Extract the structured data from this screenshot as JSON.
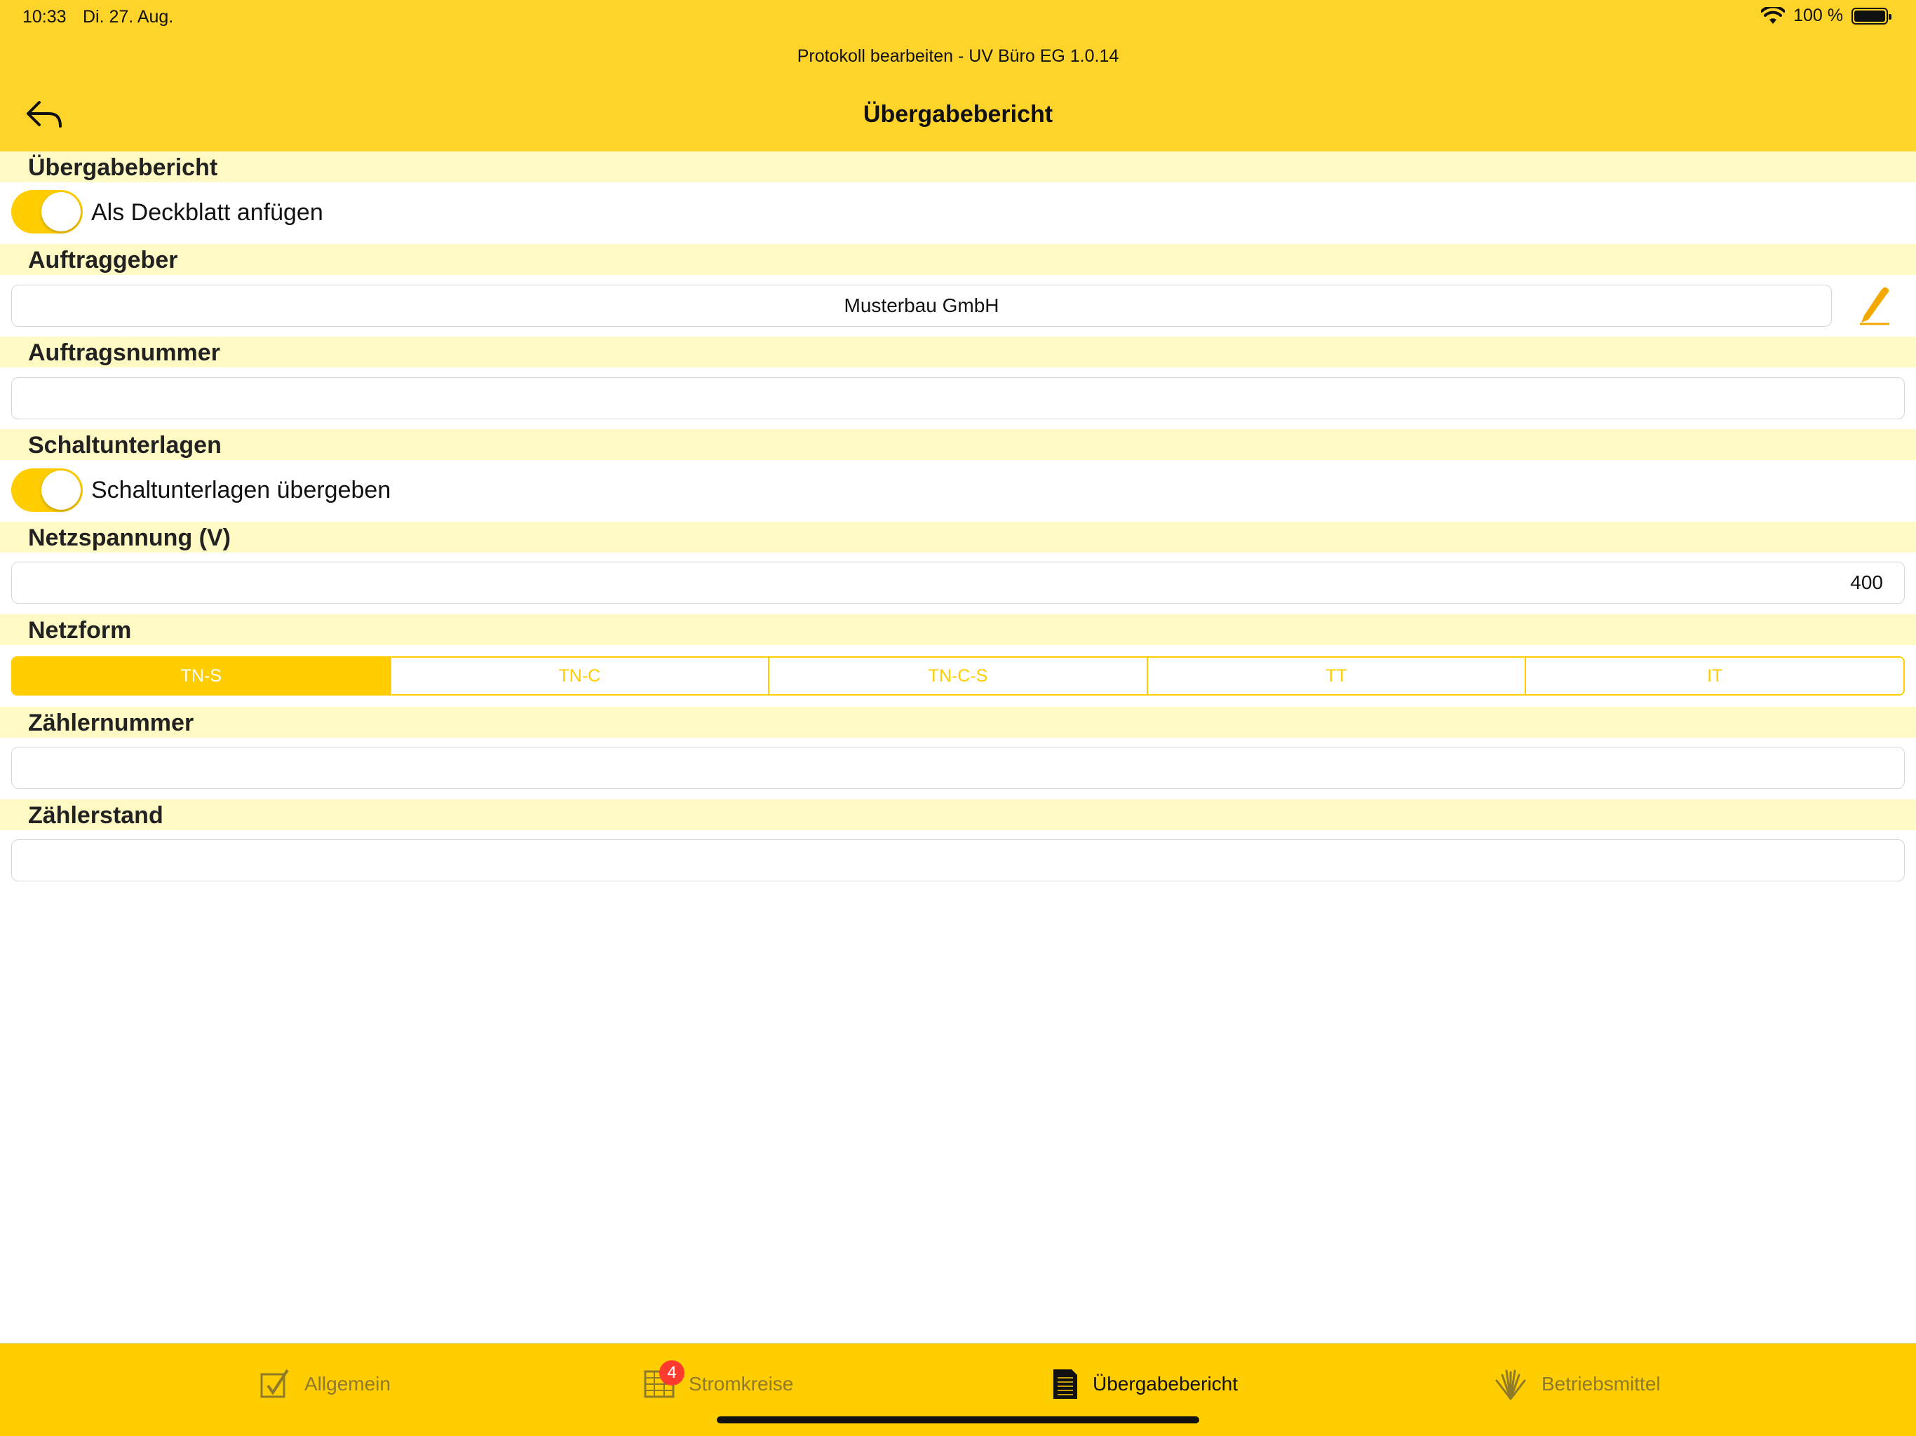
{
  "status_bar": {
    "time": "10:33",
    "date": "Di. 27. Aug.",
    "battery": "100 %"
  },
  "header": {
    "subtitle": "Protokoll bearbeiten - UV Büro EG 1.0.14",
    "title": "Übergabebericht"
  },
  "sections": {
    "uebergabebericht": {
      "label": "Übergabebericht",
      "toggle_label": "Als Deckblatt anfügen",
      "toggle_on": true
    },
    "auftraggeber": {
      "label": "Auftraggeber",
      "value": "Musterbau GmbH"
    },
    "auftragsnummer": {
      "label": "Auftragsnummer",
      "value": ""
    },
    "schaltunterlagen": {
      "label": "Schaltunterlagen",
      "toggle_label": "Schaltunterlagen übergeben",
      "toggle_on": true
    },
    "netzspannung": {
      "label": "Netzspannung (V)",
      "value": "400"
    },
    "netzform": {
      "label": "Netzform",
      "options": [
        "TN-S",
        "TN-C",
        "TN-C-S",
        "TT",
        "IT"
      ],
      "selected": "TN-S"
    },
    "zaehlernummer": {
      "label": "Zählernummer",
      "value": ""
    },
    "zaehlerstand": {
      "label": "Zählerstand",
      "value": ""
    }
  },
  "tabbar": {
    "tabs": [
      {
        "label": "Allgemein",
        "icon": "checkbox-icon"
      },
      {
        "label": "Stromkreise",
        "icon": "grid-icon",
        "badge": "4"
      },
      {
        "label": "Übergabebericht",
        "icon": "document-icon",
        "active": true
      },
      {
        "label": "Betriebsmittel",
        "icon": "burst-icon"
      }
    ]
  },
  "colors": {
    "accent": "#ffcd00",
    "header_bg": "#ffd42a",
    "section_bg": "#fff9c4",
    "badge": "#ff3b30"
  }
}
